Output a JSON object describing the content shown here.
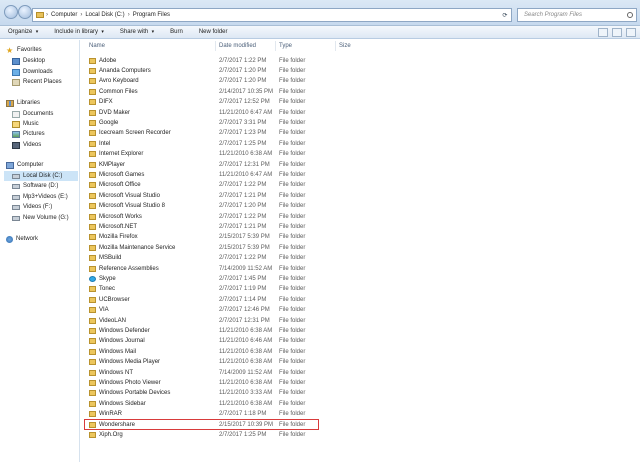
{
  "address": {
    "segments": [
      "Computer",
      "Local Disk (C:)",
      "Program Files"
    ]
  },
  "search": {
    "placeholder": "Search Program Files"
  },
  "toolbar": {
    "organize": "Organize",
    "include_library": "Include in library",
    "share_with": "Share with",
    "burn": "Burn",
    "new_folder": "New folder"
  },
  "sidebar": {
    "favorites": "Favorites",
    "desktop": "Desktop",
    "downloads": "Downloads",
    "recent": "Recent Places",
    "libraries": "Libraries",
    "documents": "Documents",
    "music": "Music",
    "pictures": "Pictures",
    "videos": "Videos",
    "computer": "Computer",
    "local_c": "Local Disk (C:)",
    "software_d": "Software (D:)",
    "mp3_e": "Mp3+Videos (E:)",
    "videos_f": "Videos (F:)",
    "new_g": "New Volume (G:)",
    "network": "Network"
  },
  "columns": {
    "name": "Name",
    "date": "Date modified",
    "type": "Type",
    "size": "Size"
  },
  "files": [
    {
      "name": "Adobe",
      "date": "2/7/2017 1:22 PM",
      "type": "File folder"
    },
    {
      "name": "Ananda Computers",
      "date": "2/7/2017 1:20 PM",
      "type": "File folder"
    },
    {
      "name": "Avro Keyboard",
      "date": "2/7/2017 1:20 PM",
      "type": "File folder"
    },
    {
      "name": "Common Files",
      "date": "2/14/2017 10:35 PM",
      "type": "File folder"
    },
    {
      "name": "DIFX",
      "date": "2/7/2017 12:52 PM",
      "type": "File folder"
    },
    {
      "name": "DVD Maker",
      "date": "11/21/2010 6:47 AM",
      "type": "File folder"
    },
    {
      "name": "Google",
      "date": "2/7/2017 3:31 PM",
      "type": "File folder"
    },
    {
      "name": "Icecream Screen Recorder",
      "date": "2/7/2017 1:23 PM",
      "type": "File folder"
    },
    {
      "name": "Intel",
      "date": "2/7/2017 1:25 PM",
      "type": "File folder"
    },
    {
      "name": "Internet Explorer",
      "date": "11/21/2010 6:38 AM",
      "type": "File folder"
    },
    {
      "name": "KMPlayer",
      "date": "2/7/2017 12:31 PM",
      "type": "File folder"
    },
    {
      "name": "Microsoft Games",
      "date": "11/21/2010 6:47 AM",
      "type": "File folder"
    },
    {
      "name": "Microsoft Office",
      "date": "2/7/2017 1:22 PM",
      "type": "File folder"
    },
    {
      "name": "Microsoft Visual Studio",
      "date": "2/7/2017 1:21 PM",
      "type": "File folder"
    },
    {
      "name": "Microsoft Visual Studio 8",
      "date": "2/7/2017 1:20 PM",
      "type": "File folder"
    },
    {
      "name": "Microsoft Works",
      "date": "2/7/2017 1:22 PM",
      "type": "File folder"
    },
    {
      "name": "Microsoft.NET",
      "date": "2/7/2017 1:21 PM",
      "type": "File folder"
    },
    {
      "name": "Mozilla Firefox",
      "date": "2/15/2017 5:39 PM",
      "type": "File folder"
    },
    {
      "name": "Mozilla Maintenance Service",
      "date": "2/15/2017 5:39 PM",
      "type": "File folder"
    },
    {
      "name": "MSBuild",
      "date": "2/7/2017 1:22 PM",
      "type": "File folder"
    },
    {
      "name": "Reference Assemblies",
      "date": "7/14/2009 11:52 AM",
      "type": "File folder"
    },
    {
      "name": "Skype",
      "date": "2/7/2017 1:45 PM",
      "type": "File folder"
    },
    {
      "name": "Tonec",
      "date": "2/7/2017 1:19 PM",
      "type": "File folder"
    },
    {
      "name": "UCBrowser",
      "date": "2/7/2017 1:14 PM",
      "type": "File folder"
    },
    {
      "name": "VIA",
      "date": "2/7/2017 12:46 PM",
      "type": "File folder"
    },
    {
      "name": "VideoLAN",
      "date": "2/7/2017 12:31 PM",
      "type": "File folder"
    },
    {
      "name": "Windows Defender",
      "date": "11/21/2010 6:38 AM",
      "type": "File folder"
    },
    {
      "name": "Windows Journal",
      "date": "11/21/2010 6:46 AM",
      "type": "File folder"
    },
    {
      "name": "Windows Mail",
      "date": "11/21/2010 6:38 AM",
      "type": "File folder"
    },
    {
      "name": "Windows Media Player",
      "date": "11/21/2010 6:38 AM",
      "type": "File folder"
    },
    {
      "name": "Windows NT",
      "date": "7/14/2009 11:52 AM",
      "type": "File folder"
    },
    {
      "name": "Windows Photo Viewer",
      "date": "11/21/2010 6:38 AM",
      "type": "File folder"
    },
    {
      "name": "Windows Portable Devices",
      "date": "11/21/2010 3:33 AM",
      "type": "File folder"
    },
    {
      "name": "Windows Sidebar",
      "date": "11/21/2010 6:38 AM",
      "type": "File folder"
    },
    {
      "name": "WinRAR",
      "date": "2/7/2017 1:18 PM",
      "type": "File folder"
    },
    {
      "name": "Wondershare",
      "date": "2/15/2017 10:39 PM",
      "type": "File folder",
      "highlighted": true
    },
    {
      "name": "Xiph.Org",
      "date": "2/7/2017 1:25 PM",
      "type": "File folder"
    }
  ],
  "colors": {
    "highlight_border": "#d83b3b",
    "folder": "#ecc65d",
    "selected_nav": "#cce4f7"
  }
}
